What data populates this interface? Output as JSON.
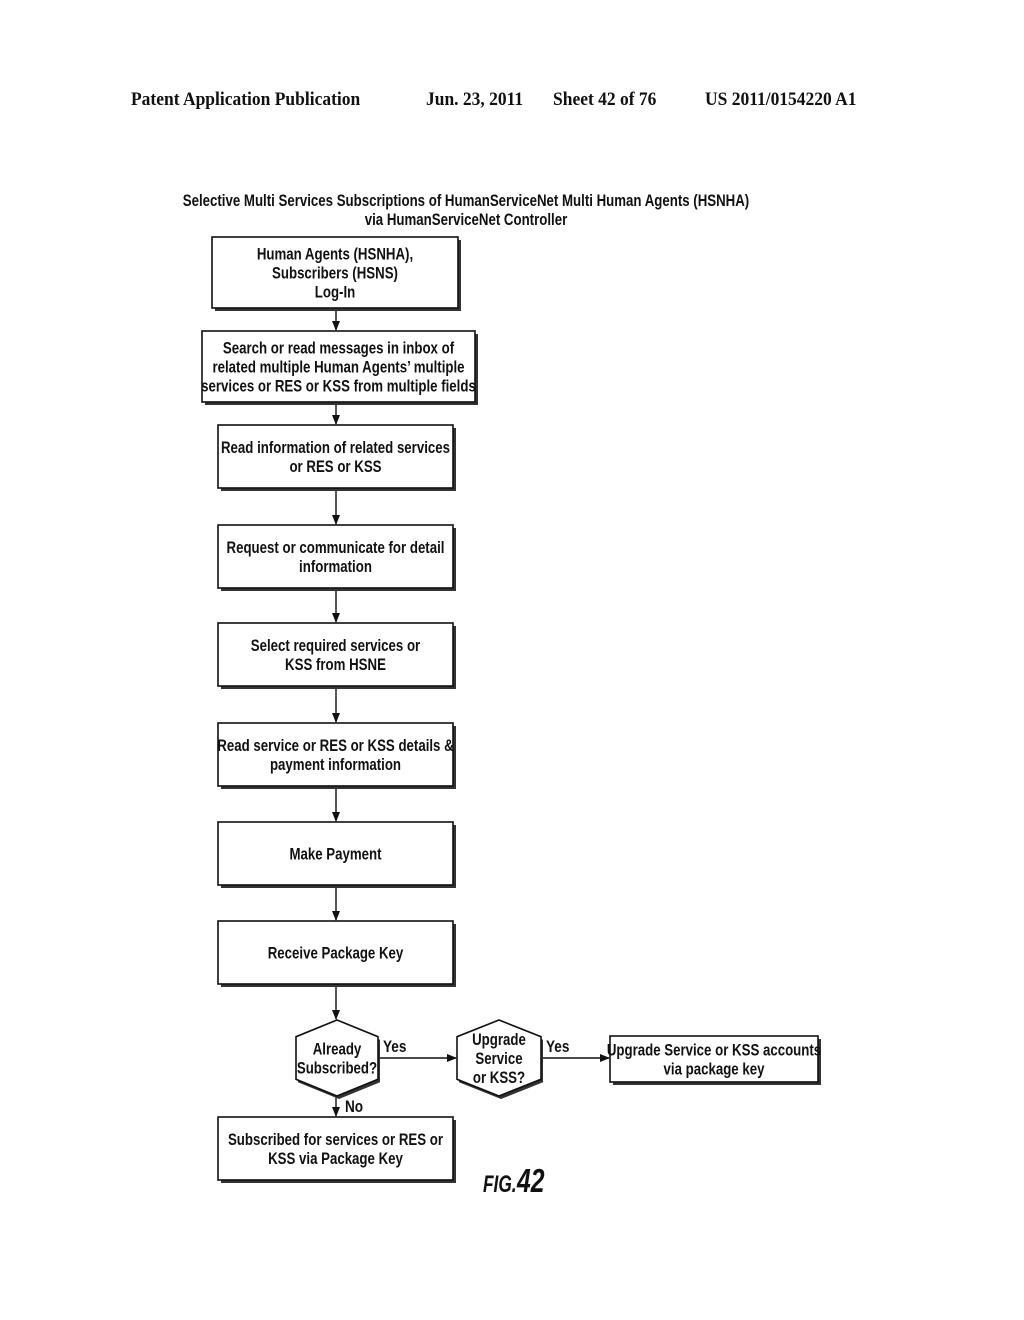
{
  "header": {
    "left": "Patent Application Publication",
    "date": "Jun. 23, 2011",
    "sheet": "Sheet 42 of 76",
    "number": "US 2011/0154220 A1"
  },
  "diagram": {
    "title_lines": [
      "Selective Multi Services Subscriptions of HumanServiceNet Multi Human Agents (HSNHA)",
      "via HumanServiceNet Controller"
    ],
    "steps": [
      {
        "id": "login",
        "lines": [
          "Human Agents (HSNHA),",
          "Subscribers (HSNS)",
          "Log-In"
        ]
      },
      {
        "id": "search",
        "lines": [
          "Search or read messages in inbox of",
          "related multiple Human Agents’ multiple",
          "services or RES or KSS from multiple fields"
        ]
      },
      {
        "id": "read-info",
        "lines": [
          "Read information of related services",
          "or RES or KSS"
        ]
      },
      {
        "id": "request",
        "lines": [
          "Request or communicate for detail",
          "information"
        ]
      },
      {
        "id": "select",
        "lines": [
          "Select required services or",
          "KSS from HSNE"
        ]
      },
      {
        "id": "read-details",
        "lines": [
          "Read service or RES or KSS details &",
          "payment information"
        ]
      },
      {
        "id": "payment",
        "lines": [
          "Make Payment"
        ]
      },
      {
        "id": "receive-key",
        "lines": [
          "Receive Package Key"
        ]
      }
    ],
    "decisions": [
      {
        "id": "already-subscribed",
        "lines": [
          "Already",
          "Subscribed?"
        ]
      },
      {
        "id": "upgrade",
        "lines": [
          "Upgrade",
          "Service",
          "or KSS?"
        ]
      }
    ],
    "upgrade_box": {
      "lines": [
        "Upgrade Service or KSS accounts",
        "via package key"
      ]
    },
    "subscribed_box": {
      "lines": [
        "Subscribed for services or RES or",
        "KSS via Package Key"
      ]
    },
    "edge_labels": {
      "yes1": "Yes",
      "yes2": "Yes",
      "no": "No"
    },
    "figure_label": {
      "prefix": "FIG.",
      "number": "42"
    }
  }
}
